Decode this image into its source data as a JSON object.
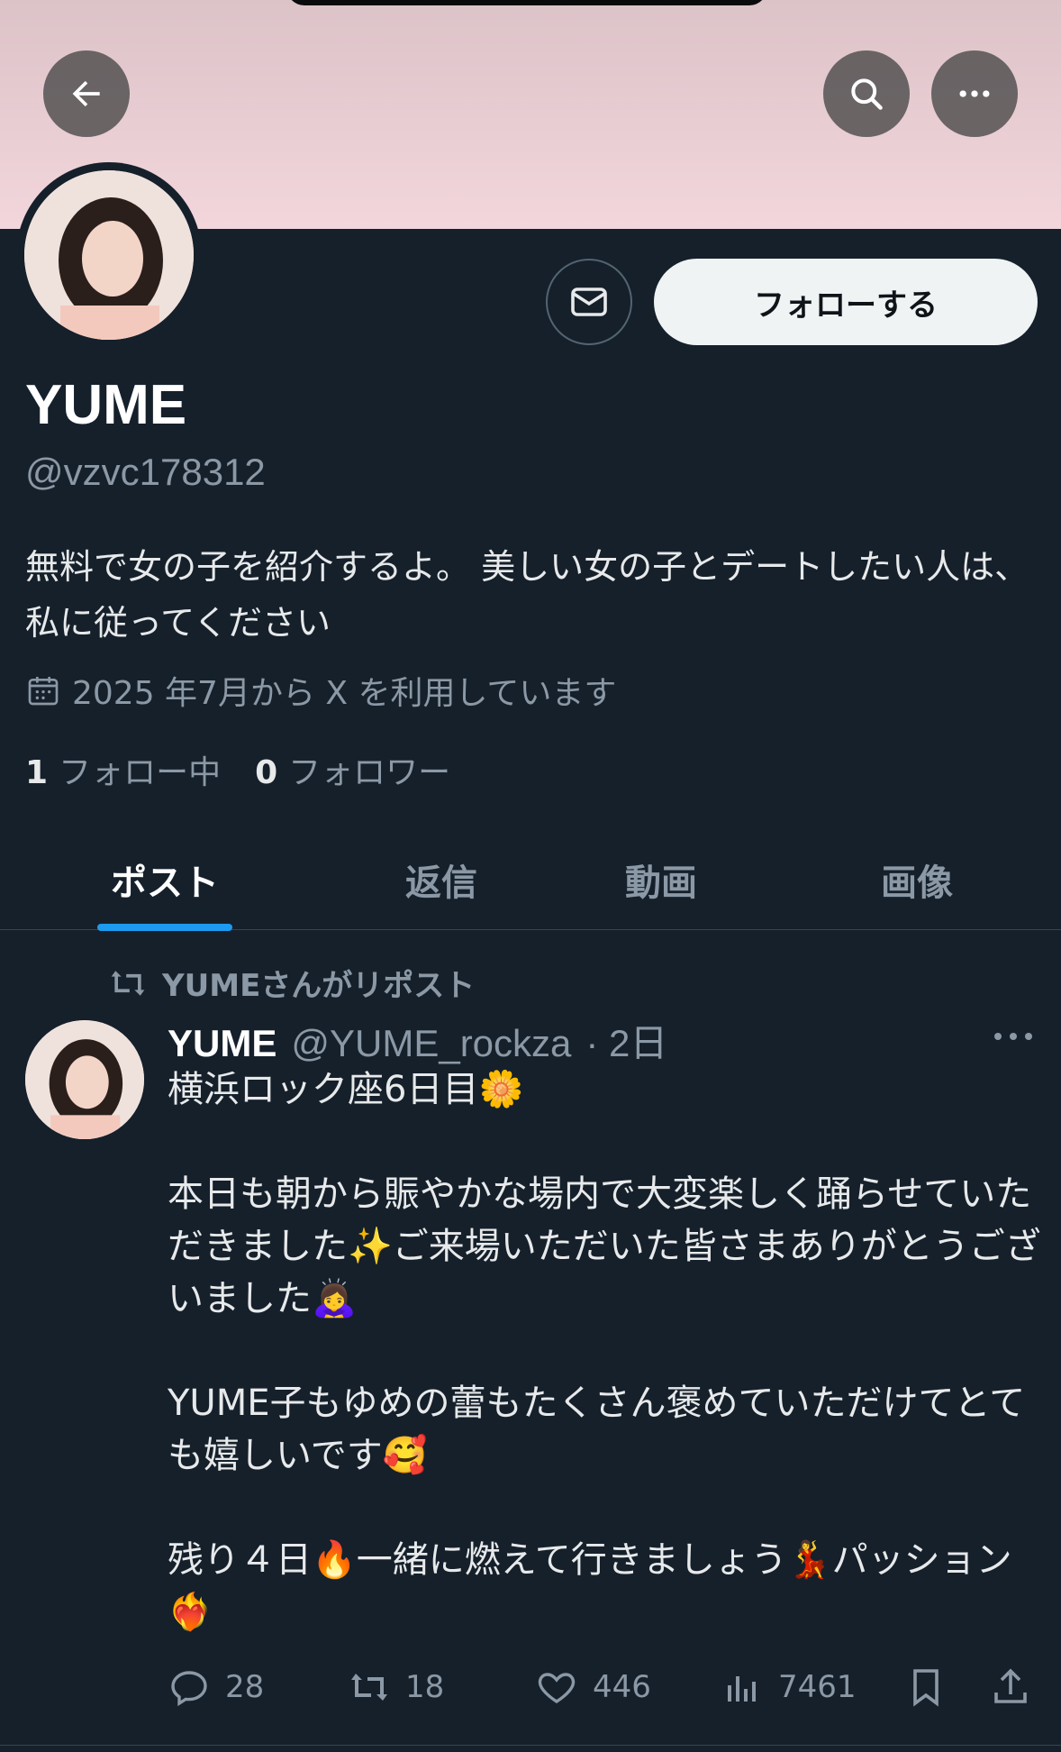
{
  "profile": {
    "name": "YUME",
    "handle": "@vzvc178312",
    "bio": "無料で女の子を紹介するよ。 美しい女の子とデートしたい人は、私に従ってください",
    "joined": "2025 年7月から X を利用しています",
    "following_count": "1",
    "following_label": "フォロー中",
    "followers_count": "0",
    "followers_label": "フォロワー"
  },
  "header": {
    "follow_label": "フォローする",
    "back_icon": "back-arrow-icon",
    "search_icon": "search-icon",
    "more_icon": "more-icon",
    "mail_icon": "mail-icon"
  },
  "tabs": [
    {
      "label": "ポスト",
      "active": true
    },
    {
      "label": "返信",
      "active": false
    },
    {
      "label": "動画",
      "active": false
    },
    {
      "label": "画像",
      "active": false
    }
  ],
  "post": {
    "repost_text": "YUMEさんがリポスト",
    "author_name": "YUME",
    "author_handle": "@YUME_rockza",
    "time": "· 2日",
    "body": "横浜ロック座6日目🌼\n\n本日も朝から賑やかな場内で大変楽しく踊らせていただきました✨ご来場いただいた皆さまありがとうございました🙇‍♀️\n\nYUME子もゆめの蕾もたくさん褒めていただけてとても嬉しいです🥰\n\n残り４日🔥一緒に燃えて行きましょう💃パッション❤️‍🔥",
    "replies": "28",
    "reposts": "18",
    "likes": "446",
    "views": "7461"
  },
  "colors": {
    "background": "#15202b",
    "accent": "#1d9bf0",
    "banner": "#f2d6dc",
    "muted": "#8b98a5"
  }
}
